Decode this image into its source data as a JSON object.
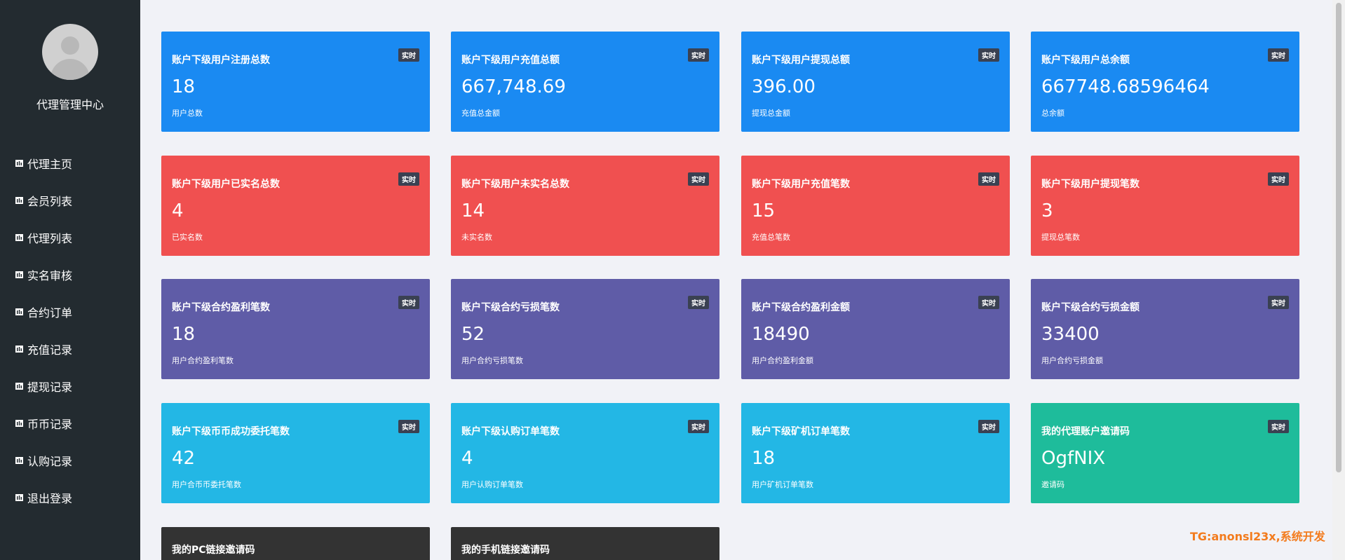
{
  "sidebar": {
    "brand": "代理管理中心",
    "items": [
      {
        "label": "代理主页"
      },
      {
        "label": "会员列表"
      },
      {
        "label": "代理列表"
      },
      {
        "label": "实名审核"
      },
      {
        "label": "合约订单"
      },
      {
        "label": "充值记录"
      },
      {
        "label": "提现记录"
      },
      {
        "label": "币币记录"
      },
      {
        "label": "认购记录"
      },
      {
        "label": "退出登录"
      }
    ]
  },
  "cards": [
    {
      "title": "账户下级用户注册总数",
      "badge": "实时",
      "value": "18",
      "sub": "用户总数"
    },
    {
      "title": "账户下级用户充值总额",
      "badge": "实时",
      "value": "667,748.69",
      "sub": "充值总金额"
    },
    {
      "title": "账户下级用户提现总额",
      "badge": "实时",
      "value": "396.00",
      "sub": "提现总金额"
    },
    {
      "title": "账户下级用户总余额",
      "badge": "实时",
      "value": "667748.68596464",
      "sub": "总余额"
    },
    {
      "title": "账户下级用户已实名总数",
      "badge": "实时",
      "value": "4",
      "sub": "已实名数"
    },
    {
      "title": "账户下级用户未实名总数",
      "badge": "实时",
      "value": "14",
      "sub": "未实名数"
    },
    {
      "title": "账户下级用户充值笔数",
      "badge": "实时",
      "value": "15",
      "sub": "充值总笔数"
    },
    {
      "title": "账户下级用户提现笔数",
      "badge": "实时",
      "value": "3",
      "sub": "提现总笔数"
    },
    {
      "title": "账户下级合约盈利笔数",
      "badge": "实时",
      "value": "18",
      "sub": "用户合约盈利笔数"
    },
    {
      "title": "账户下级合约亏损笔数",
      "badge": "实时",
      "value": "52",
      "sub": "用户合约亏损笔数"
    },
    {
      "title": "账户下级合约盈利金额",
      "badge": "实时",
      "value": "18490",
      "sub": "用户合约盈利金额"
    },
    {
      "title": "账户下级合约亏损金额",
      "badge": "实时",
      "value": "33400",
      "sub": "用户合约亏损金额"
    },
    {
      "title": "账户下级币币成功委托笔数",
      "badge": "实时",
      "value": "42",
      "sub": "用户合币币委托笔数"
    },
    {
      "title": "账户下级认购订单笔数",
      "badge": "实时",
      "value": "4",
      "sub": "用户认购订单笔数"
    },
    {
      "title": "账户下级矿机订单笔数",
      "badge": "实时",
      "value": "18",
      "sub": "用户矿机订单笔数"
    },
    {
      "title": "我的代理账户邀请码",
      "badge": "实时",
      "value": "OgfNIX",
      "sub": "邀请码"
    },
    {
      "title": "我的PC链接邀请码"
    },
    {
      "title": "我的手机链接邀请码"
    }
  ],
  "watermark": "TG:anonsl23x,系统开发",
  "colors": {
    "sidebar_bg": "#232b30",
    "blue": "#1a8af2",
    "red": "#f05050",
    "purple": "#5f5ca7",
    "cyan": "#23b7e5",
    "green": "#1ebc9b",
    "dark": "#333333",
    "badge_bg": "#3a4152",
    "watermark": "#f37b1d"
  }
}
